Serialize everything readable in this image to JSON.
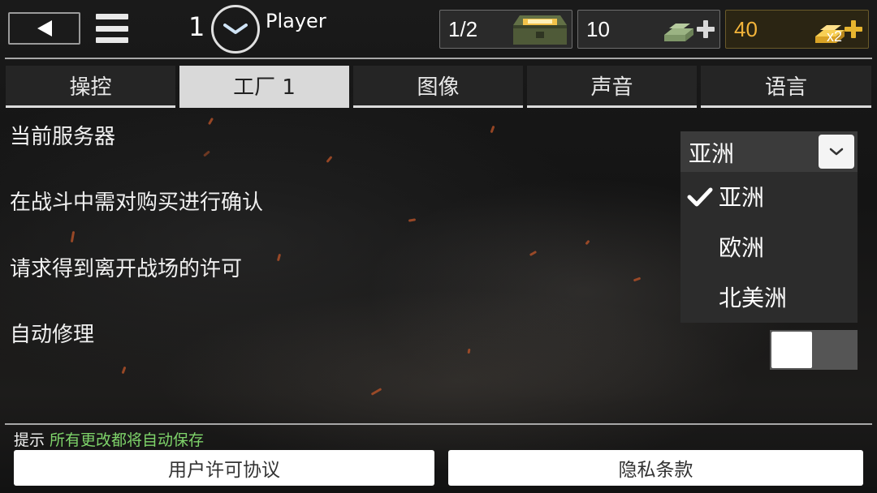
{
  "header": {
    "back_icon": "back-arrow-icon",
    "menu_icon": "hamburger-menu-icon",
    "level": "1",
    "level_icon": "chevron-down-icon",
    "player_name": "Player",
    "crates": {
      "value": "1/2",
      "icon": "ammo-crate-icon"
    },
    "silver": {
      "value": "10",
      "icon": "silver-bars-icon",
      "add_icon": "plus-icon"
    },
    "gold": {
      "value": "40",
      "icon": "gold-bars-icon",
      "multiplier": "x2",
      "add_icon": "plus-icon",
      "color": "#f3b43a"
    }
  },
  "tabs": [
    {
      "label": "操控",
      "active": false
    },
    {
      "label": "工厂 1",
      "active": true
    },
    {
      "label": "图像",
      "active": false
    },
    {
      "label": "声音",
      "active": false
    },
    {
      "label": "语言",
      "active": false
    }
  ],
  "settings": [
    {
      "label": "当前服务器"
    },
    {
      "label": "在战斗中需对购买进行确认"
    },
    {
      "label": "请求得到离开战场的许可"
    },
    {
      "label": "自动修理"
    }
  ],
  "server_dropdown": {
    "selected": "亚洲",
    "options": [
      "亚洲",
      "欧洲",
      "北美洲"
    ],
    "checked_index": 0
  },
  "auto_repair_toggle": {
    "on": false
  },
  "footer": {
    "hint_label": "提示",
    "hint_text": "所有更改都将自动保存",
    "hint_color": "#7ed36a",
    "license_button": "用户许可协议",
    "privacy_button": "隐私条款"
  }
}
